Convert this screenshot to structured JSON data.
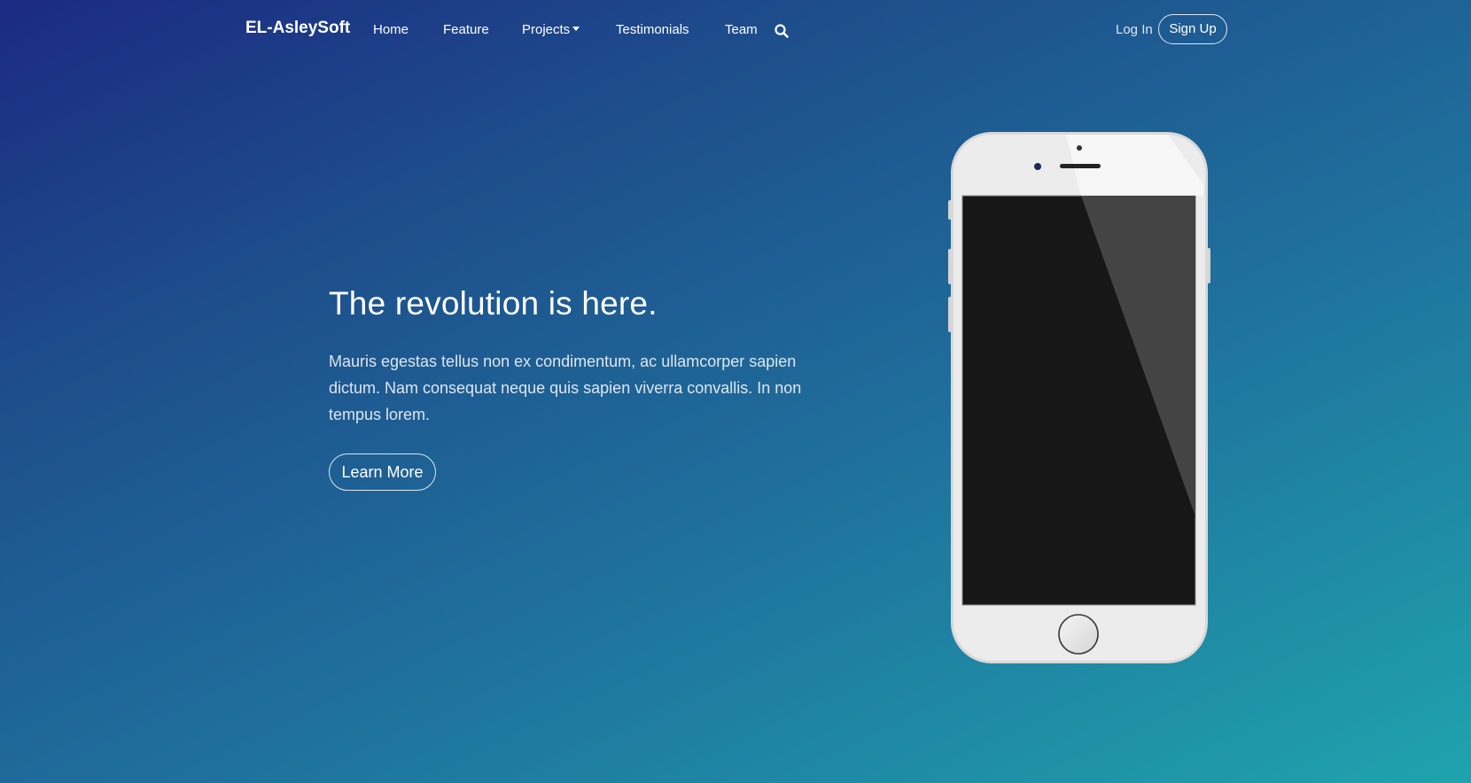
{
  "navbar": {
    "brand": "EL-AsleySoft",
    "links": [
      {
        "label": "Home"
      },
      {
        "label": "Feature"
      },
      {
        "label": "Projects"
      },
      {
        "label": "Testimonials"
      },
      {
        "label": "Team"
      }
    ],
    "search_icon": "search-icon",
    "login_label": "Log In",
    "signup_label": "Sign Up"
  },
  "hero": {
    "title": "The revolution is here.",
    "text": "Mauris egestas tellus non ex condimentum, ac ullamcorper sapien dictum. Nam consequat neque quis sapien viverra convallis. In non tempus lorem.",
    "button_label": "Learn More"
  },
  "phone": {
    "icon": "smartphone-illustration",
    "body_color": "#ececec",
    "screen_color": "#171718",
    "reflection_color": "#444444"
  },
  "colors": {
    "gradient_start": "#1b2a82",
    "gradient_end": "#1fa3ad",
    "text": "#ffffff"
  }
}
